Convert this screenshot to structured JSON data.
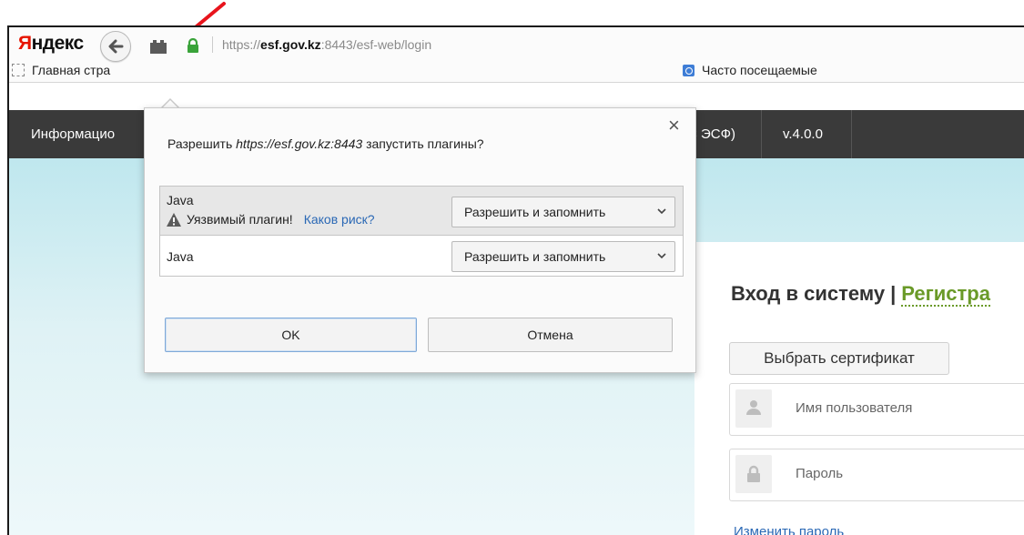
{
  "browser": {
    "logo": {
      "first": "Я",
      "rest": "ндекс"
    },
    "url": {
      "scheme": "https://",
      "host": "esf.gov.kz",
      "rest": ":8443/esf-web/login"
    },
    "icons": {
      "back": "back-arrow-icon",
      "plugin": "plugin-block-icon",
      "lock": "lock-icon"
    },
    "bookmarks": {
      "home": "Главная стра",
      "frequent": "Часто посещаемые"
    }
  },
  "site": {
    "nav": {
      "info": "Информацио",
      "system": "С ЭСФ)",
      "version": "v.4.0.0"
    }
  },
  "dialog": {
    "question_prefix": "Разрешить ",
    "question_site": "https://esf.gov.kz:8443",
    "question_suffix": " запустить плагины?",
    "close": "×",
    "plugins": [
      {
        "name": "Java",
        "warning": "Уязвимый плагин!",
        "risk_link": "Каков риск?",
        "action": "Разрешить и запомнить"
      },
      {
        "name": "Java",
        "action": "Разрешить и запомнить"
      }
    ],
    "ok": "OK",
    "cancel": "Отмена"
  },
  "login": {
    "title": "Вход в систему",
    "separator": "|",
    "register": "Регистра",
    "select_cert": "Выбрать сертификат",
    "username_placeholder": "Имя пользователя",
    "password_placeholder": "Пароль",
    "change_password": "Изменить пароль"
  },
  "colors": {
    "annotation_arrow": "#e8141c",
    "header_bg": "#3a3a3a",
    "register_link": "#6a9a28",
    "link": "#2a68b5"
  }
}
